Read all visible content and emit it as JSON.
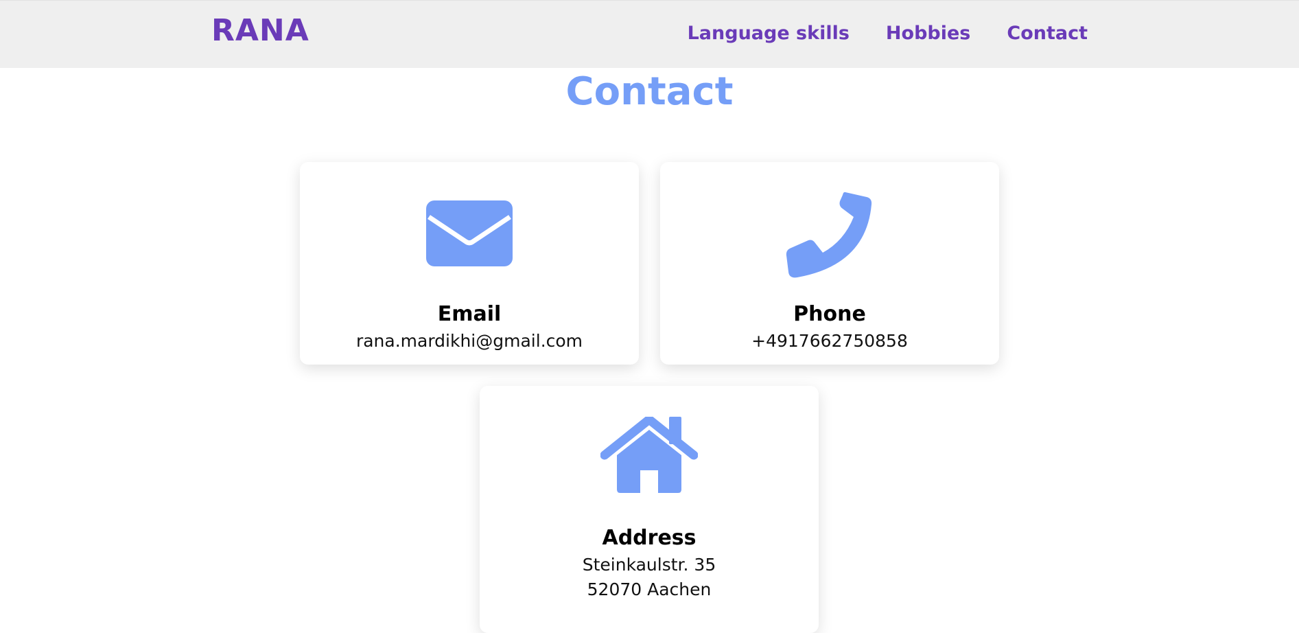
{
  "header": {
    "brand": "RANA",
    "nav": [
      "Language skills",
      "Hobbies",
      "Contact"
    ]
  },
  "section": {
    "title": "Contact"
  },
  "cards": {
    "email": {
      "icon": "envelope-icon",
      "title": "Email",
      "value": "rana.mardikhi@gmail.com"
    },
    "phone": {
      "icon": "phone-icon",
      "title": "Phone",
      "value": "+4917662750858"
    },
    "address": {
      "icon": "house-icon",
      "title": "Address",
      "lines": [
        "Steinkaulstr. 35",
        "52070 Aachen"
      ]
    }
  },
  "colors": {
    "accent_purple": "#6a3bb8",
    "icon_blue": "#759ef7",
    "nav_bg": "#efefef"
  }
}
